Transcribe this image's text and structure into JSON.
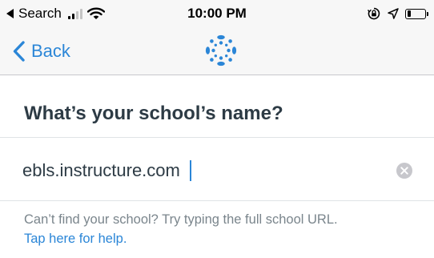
{
  "status_bar": {
    "back_app": "Search",
    "time": "10:00 PM",
    "battery_level": 0.2
  },
  "nav": {
    "back_label": "Back",
    "logo_icon": "canvas-logo-icon",
    "accent_color": "#2b86d7"
  },
  "form": {
    "heading": "What’s your school’s name?",
    "url_value": "ebls.instructure.com",
    "clear_icon": "clear-icon"
  },
  "help": {
    "text": "Can’t find your school? Try typing the full school URL.",
    "link": "Tap here for help."
  }
}
